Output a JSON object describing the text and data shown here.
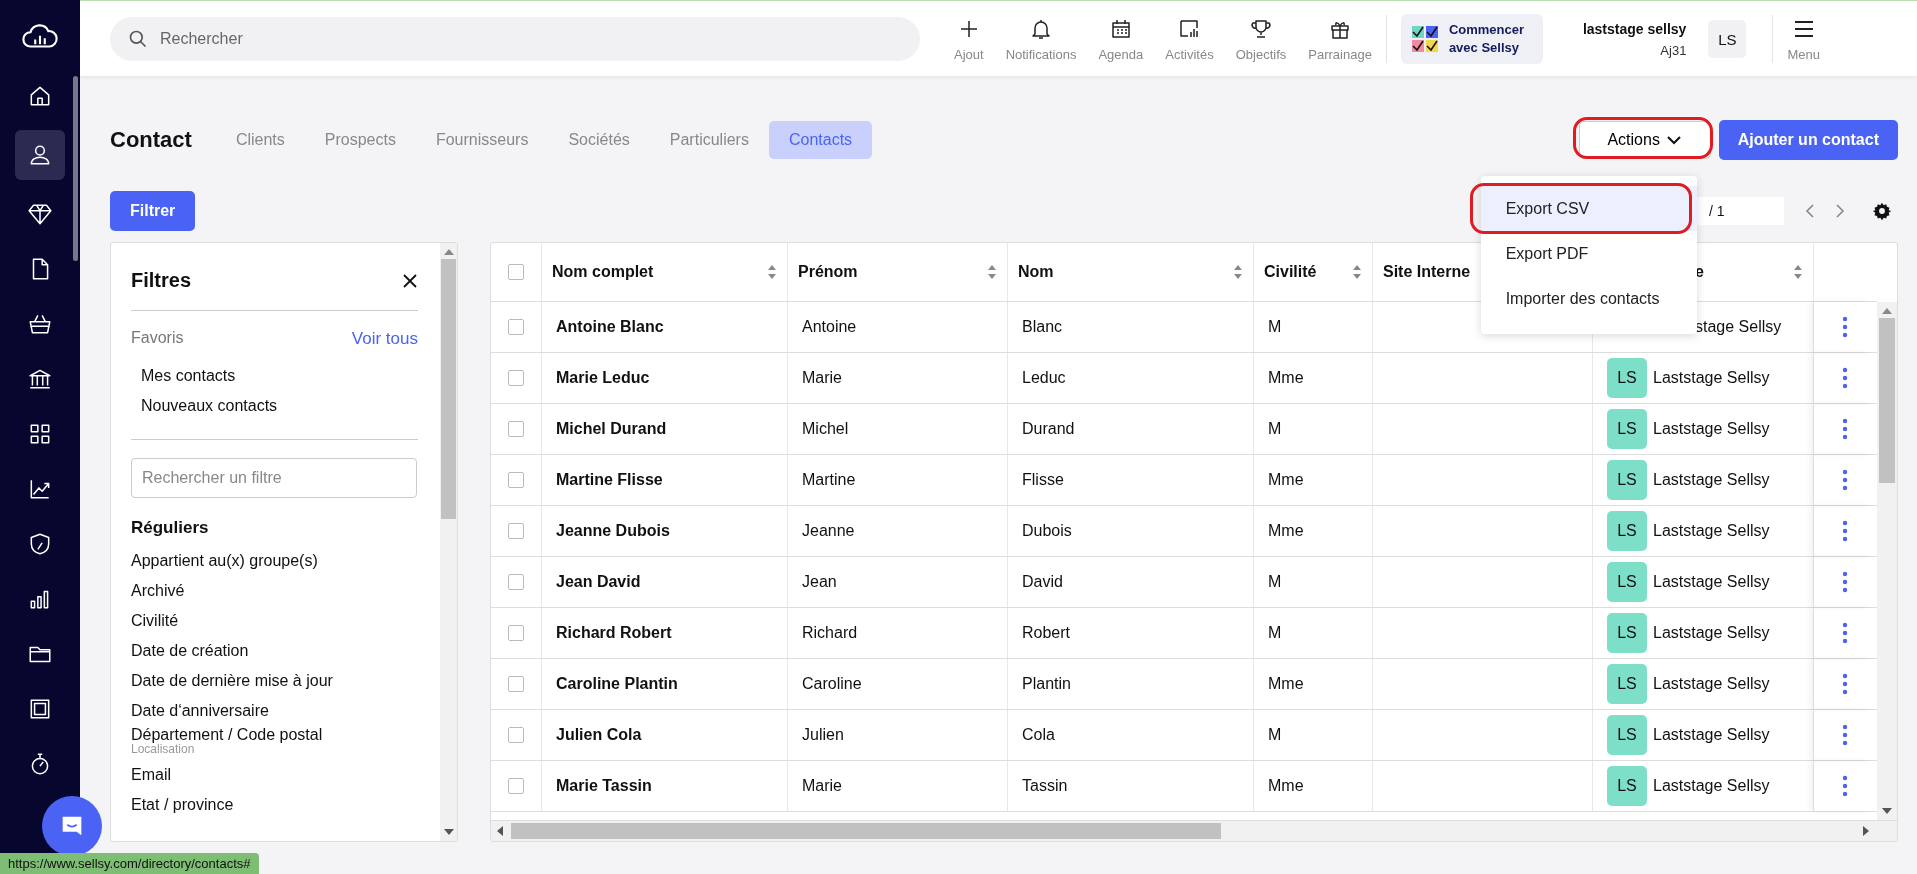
{
  "topbar": {
    "search": {
      "placeholder": "Rechercher"
    },
    "actions": [
      {
        "label": "Ajout",
        "kind": "plus"
      },
      {
        "label": "Notifications",
        "kind": "bell"
      },
      {
        "label": "Agenda",
        "kind": "calendar"
      },
      {
        "label": "Activités",
        "kind": "activity"
      },
      {
        "label": "Objectifs",
        "kind": "trophy"
      },
      {
        "label": "Parrainage",
        "kind": "gift"
      }
    ],
    "onboarding": "Commencer avec Sellsy",
    "user": {
      "name": "laststage sellsy",
      "account": "Aj31",
      "initials": "LS"
    },
    "menu": "Menu"
  },
  "sidebar": {
    "items": [
      {
        "kind": "home",
        "selected": false
      },
      {
        "kind": "person",
        "selected": true
      },
      {
        "kind": "diamond",
        "selected": false
      },
      {
        "kind": "file",
        "selected": false
      },
      {
        "kind": "basket",
        "selected": false
      },
      {
        "kind": "bank",
        "selected": false
      },
      {
        "kind": "grid",
        "selected": false
      },
      {
        "kind": "chart",
        "selected": false
      },
      {
        "kind": "shield",
        "selected": false
      },
      {
        "kind": "bars",
        "selected": false
      },
      {
        "kind": "folder",
        "selected": false
      },
      {
        "kind": "stamp",
        "selected": false
      },
      {
        "kind": "stopwatch",
        "selected": false
      }
    ]
  },
  "page": {
    "title": "Contact",
    "tabs": [
      {
        "label": "Clients",
        "selected": false
      },
      {
        "label": "Prospects",
        "selected": false
      },
      {
        "label": "Fournisseurs",
        "selected": false
      },
      {
        "label": "Sociétés",
        "selected": false
      },
      {
        "label": "Particuliers",
        "selected": false
      },
      {
        "label": "Contacts",
        "selected": true
      }
    ],
    "actions_button": {
      "label": "Actions",
      "annotated": true
    },
    "add_button": "Ajouter un contact",
    "filter_button": "Filtrer",
    "pager": {
      "total": "/ 1"
    }
  },
  "dropdown": {
    "items": [
      {
        "label": "Export CSV",
        "selected": true,
        "annotated": true
      },
      {
        "label": "Export PDF",
        "selected": false,
        "annotated": false
      },
      {
        "label": "Importer des contacts",
        "selected": false,
        "annotated": false
      }
    ]
  },
  "filters": {
    "title": "Filtres",
    "favorites_label": "Favoris",
    "see_all": "Voir tous",
    "favorites": [
      "Mes contacts",
      "Nouveaux contacts"
    ],
    "search": {
      "placeholder": "Rechercher un filtre"
    },
    "section": "Réguliers",
    "items": [
      {
        "label": "Appartient au(x) groupe(s)"
      },
      {
        "label": "Archivé"
      },
      {
        "label": "Civilité"
      },
      {
        "label": "Date de création"
      },
      {
        "label": "Date de dernière mise à jour"
      },
      {
        "label": "Date d‘anniversaire"
      },
      {
        "label": "Département / Code postal",
        "note": "Localisation"
      },
      {
        "label": "Email"
      },
      {
        "label": "Etat / province"
      }
    ]
  },
  "table": {
    "select_all": {
      "checked": false
    },
    "columns": [
      {
        "label": "Nom complet",
        "sortable": true
      },
      {
        "label": "Prénom",
        "sortable": true
      },
      {
        "label": "Nom",
        "sortable": true
      },
      {
        "label": "Civilité",
        "sortable": true
      },
      {
        "label": "Site Interne",
        "sortable": false
      },
      {
        "label": "e",
        "sortable": true
      }
    ],
    "rows": [
      {
        "checked": false,
        "full_name": "Antoine Blanc",
        "first_name": "Antoine",
        "last_name": "Blanc",
        "civility": "M",
        "owner": {
          "name": "stage Sellsy",
          "cut": true
        }
      },
      {
        "checked": false,
        "full_name": "Marie Leduc",
        "first_name": "Marie",
        "last_name": "Leduc",
        "civility": "Mme",
        "owner": {
          "initials": "LS",
          "name": "Laststage Sellsy"
        }
      },
      {
        "checked": false,
        "full_name": "Michel Durand",
        "first_name": "Michel",
        "last_name": "Durand",
        "civility": "M",
        "owner": {
          "initials": "LS",
          "name": "Laststage Sellsy"
        }
      },
      {
        "checked": false,
        "full_name": "Martine Flisse",
        "first_name": "Martine",
        "last_name": "Flisse",
        "civility": "Mme",
        "owner": {
          "initials": "LS",
          "name": "Laststage Sellsy"
        }
      },
      {
        "checked": false,
        "full_name": "Jeanne Dubois",
        "first_name": "Jeanne",
        "last_name": "Dubois",
        "civility": "Mme",
        "owner": {
          "initials": "LS",
          "name": "Laststage Sellsy"
        }
      },
      {
        "checked": false,
        "full_name": "Jean David",
        "first_name": "Jean",
        "last_name": "David",
        "civility": "M",
        "owner": {
          "initials": "LS",
          "name": "Laststage Sellsy"
        }
      },
      {
        "checked": false,
        "full_name": "Richard Robert",
        "first_name": "Richard",
        "last_name": "Robert",
        "civility": "M",
        "owner": {
          "initials": "LS",
          "name": "Laststage Sellsy"
        }
      },
      {
        "checked": false,
        "full_name": "Caroline Plantin",
        "first_name": "Caroline",
        "last_name": "Plantin",
        "civility": "Mme",
        "owner": {
          "initials": "LS",
          "name": "Laststage Sellsy"
        }
      },
      {
        "checked": false,
        "full_name": "Julien Cola",
        "first_name": "Julien",
        "last_name": "Cola",
        "civility": "M",
        "owner": {
          "initials": "LS",
          "name": "Laststage Sellsy"
        }
      },
      {
        "checked": false,
        "full_name": "Marie Tassin",
        "first_name": "Marie",
        "last_name": "Tassin",
        "civility": "Mme",
        "owner": {
          "initials": "LS",
          "name": "Laststage Sellsy"
        }
      }
    ]
  },
  "status_bar": "https://www.sellsy.com/directory/contacts#"
}
